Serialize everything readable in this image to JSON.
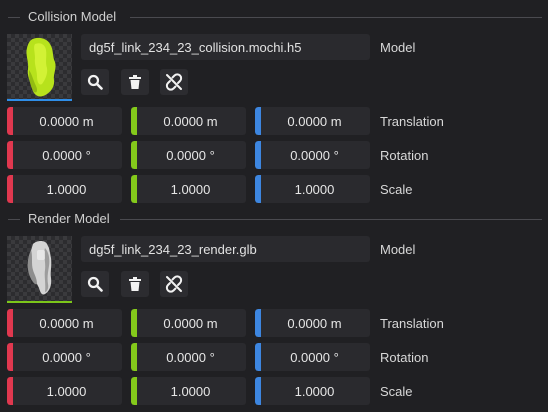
{
  "colors": {
    "x_axis": "#e0384f",
    "y_axis": "#84c91b",
    "z_axis": "#3d86e0",
    "collision_underline": "#2f8ee8",
    "render_underline": "#7cc61a"
  },
  "sections": [
    {
      "title": "Collision Model",
      "thumbnail": "collision-mesh-preview",
      "file": "dg5f_link_234_23_collision.mochi.h5",
      "file_label": "Model",
      "buttons": [
        {
          "icon": "search-icon"
        },
        {
          "icon": "trash-icon"
        },
        {
          "icon": "unlink-icon"
        }
      ],
      "rows": [
        {
          "label": "Translation",
          "x": "0.0000 m",
          "y": "0.0000 m",
          "z": "0.0000 m"
        },
        {
          "label": "Rotation",
          "x": "0.0000 °",
          "y": "0.0000 °",
          "z": "0.0000 °"
        },
        {
          "label": "Scale",
          "x": "1.0000",
          "y": "1.0000",
          "z": "1.0000"
        }
      ]
    },
    {
      "title": "Render Model",
      "thumbnail": "render-mesh-preview",
      "file": "dg5f_link_234_23_render.glb",
      "file_label": "Model",
      "buttons": [
        {
          "icon": "search-icon"
        },
        {
          "icon": "trash-icon"
        },
        {
          "icon": "unlink-icon"
        }
      ],
      "rows": [
        {
          "label": "Translation",
          "x": "0.0000 m",
          "y": "0.0000 m",
          "z": "0.0000 m"
        },
        {
          "label": "Rotation",
          "x": "0.0000 °",
          "y": "0.0000 °",
          "z": "0.0000 °"
        },
        {
          "label": "Scale",
          "x": "1.0000",
          "y": "1.0000",
          "z": "1.0000"
        }
      ]
    }
  ]
}
